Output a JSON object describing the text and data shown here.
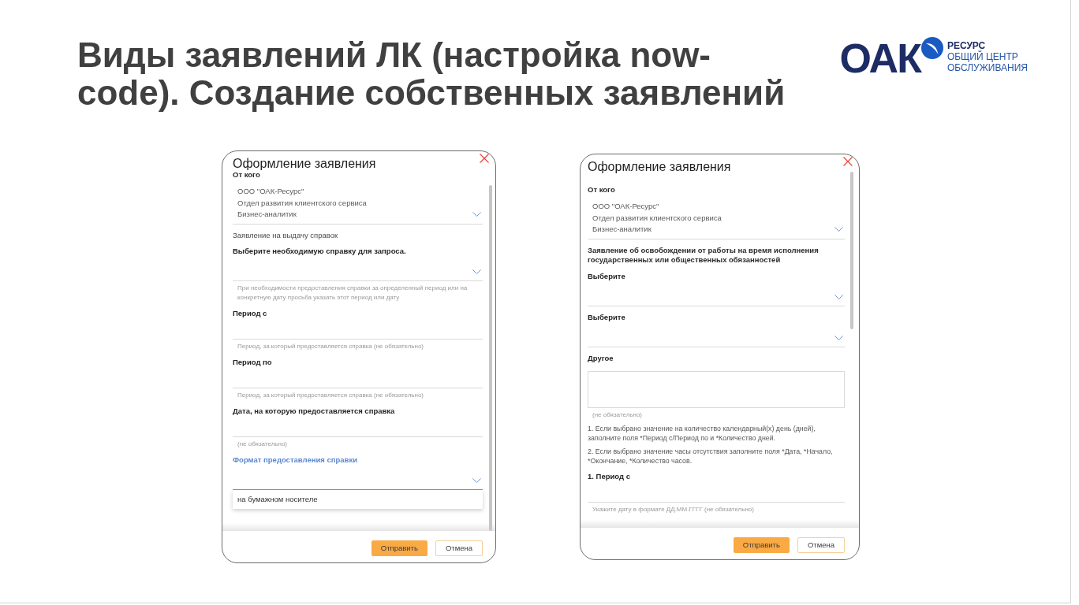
{
  "title_lines": [
    "Виды заявлений ЛК (настройка now-",
    "code). Создание собственных заявлений"
  ],
  "logo": {
    "wordmark": "ОАК",
    "lines": [
      "РЕСУРС",
      "ОБЩИЙ ЦЕНТР",
      "ОБСЛУЖИВАНИЯ"
    ]
  },
  "dialogs": [
    {
      "title": "Оформление заявления",
      "fields": [
        {
          "kind": "select",
          "label": "От кого",
          "value_lines": [
            "ООО \"ОАК-Ресурс\"",
            "Отдел развития клиентского сервиса",
            "Бизнес-аналитик"
          ],
          "expanded": false
        },
        {
          "kind": "note",
          "text": "Заявление на выдачу справок",
          "bold": false
        },
        {
          "kind": "select",
          "label": "Выберите необходимую справку для запроса.",
          "hint": "При необходимости предоставления справки за определенный период или на конкретную дату просьба указать этот период или дату",
          "expanded": false
        },
        {
          "kind": "input",
          "label": "Период с",
          "hint": "Период, за который предоставляется справка (не обязательно)"
        },
        {
          "kind": "input",
          "label": "Период по",
          "hint": "Период, за который предоставляется справка (не обязательно)"
        },
        {
          "kind": "input",
          "label": "Дата, на которую предоставляется справка",
          "hint": "(не обязательно)"
        },
        {
          "kind": "select",
          "label": "Формат предоставления справки",
          "expanded": true,
          "options": [
            "на бумажном носителе"
          ]
        }
      ],
      "buttons": [
        {
          "label": "Отправить",
          "primary": true
        },
        {
          "label": "Отмена",
          "primary": false
        }
      ]
    },
    {
      "title": "Оформление заявления",
      "fields": [
        {
          "kind": "select",
          "label": "От кого",
          "value_lines": [
            "ООО \"ОАК-Ресурс\"",
            "Отдел развития клиентского сервиса",
            "Бизнес-аналитик"
          ],
          "expanded": false
        },
        {
          "kind": "note",
          "text": "Заявление об освобождении от работы на время исполнения государственных или общественных обязанностей",
          "bold": true
        },
        {
          "kind": "select",
          "label": "Выберите",
          "expanded": false
        },
        {
          "kind": "select",
          "label": "Выберите",
          "expanded": false
        },
        {
          "kind": "textarea",
          "label": "Другое",
          "hint": "(не обязательно)"
        },
        {
          "kind": "instruction",
          "text": "1. Если выбрано значение на количество календарный(х) день (дней), заполните поля *Период с/Период по и *Количество дней."
        },
        {
          "kind": "instruction",
          "text": "2. Если выбрано значение часы отсутствия заполните поля *Дата, *Начало, *Окончание, *Количество часов."
        },
        {
          "kind": "input",
          "label": "1. Период с",
          "hint": "Укажите дату в формате ДД.ММ.ГГГГ (не обязательно)"
        }
      ],
      "buttons": [
        {
          "label": "Отправить",
          "primary": true
        },
        {
          "label": "Отмена",
          "primary": false
        }
      ]
    }
  ]
}
